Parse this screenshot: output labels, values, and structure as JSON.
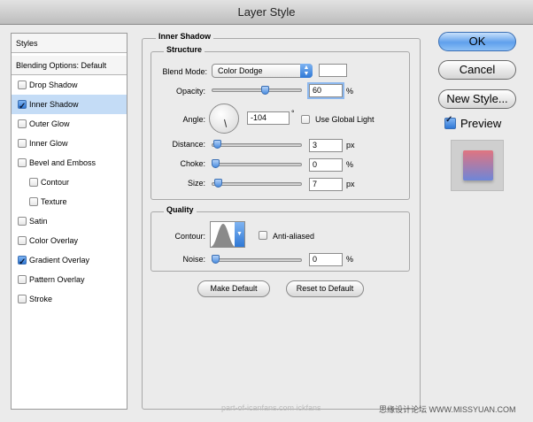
{
  "window": {
    "title": "Layer Style"
  },
  "sidebar": {
    "header": "Styles",
    "blending": "Blending Options: Default",
    "items": [
      {
        "label": "Drop Shadow",
        "checked": false,
        "selected": false,
        "indent": false
      },
      {
        "label": "Inner Shadow",
        "checked": true,
        "selected": true,
        "indent": false
      },
      {
        "label": "Outer Glow",
        "checked": false,
        "selected": false,
        "indent": false
      },
      {
        "label": "Inner Glow",
        "checked": false,
        "selected": false,
        "indent": false
      },
      {
        "label": "Bevel and Emboss",
        "checked": false,
        "selected": false,
        "indent": false
      },
      {
        "label": "Contour",
        "checked": false,
        "selected": false,
        "indent": true
      },
      {
        "label": "Texture",
        "checked": false,
        "selected": false,
        "indent": true
      },
      {
        "label": "Satin",
        "checked": false,
        "selected": false,
        "indent": false
      },
      {
        "label": "Color Overlay",
        "checked": false,
        "selected": false,
        "indent": false
      },
      {
        "label": "Gradient Overlay",
        "checked": true,
        "selected": false,
        "indent": false
      },
      {
        "label": "Pattern Overlay",
        "checked": false,
        "selected": false,
        "indent": false
      },
      {
        "label": "Stroke",
        "checked": false,
        "selected": false,
        "indent": false
      }
    ]
  },
  "inner_shadow": {
    "section_title": "Inner Shadow",
    "structure": {
      "title": "Structure",
      "blend_mode_label": "Blend Mode:",
      "blend_mode_value": "Color Dodge",
      "blend_color": "#ffffff",
      "opacity_label": "Opacity:",
      "opacity_value": "60",
      "opacity_unit": "%",
      "opacity_fraction": 0.6,
      "angle_label": "Angle:",
      "angle_value": "-104",
      "angle_unit": "°",
      "use_global_light_label": "Use Global Light",
      "use_global_light_checked": false,
      "distance_label": "Distance:",
      "distance_value": "3",
      "distance_unit": "px",
      "distance_fraction": 0.02,
      "choke_label": "Choke:",
      "choke_value": "0",
      "choke_unit": "%",
      "choke_fraction": 0,
      "size_label": "Size:",
      "size_value": "7",
      "size_unit": "px",
      "size_fraction": 0.03
    },
    "quality": {
      "title": "Quality",
      "contour_label": "Contour:",
      "anti_aliased_label": "Anti-aliased",
      "anti_aliased_checked": false,
      "noise_label": "Noise:",
      "noise_value": "0",
      "noise_unit": "%",
      "noise_fraction": 0
    },
    "make_default_label": "Make Default",
    "reset_default_label": "Reset to Default"
  },
  "buttons": {
    "ok": "OK",
    "cancel": "Cancel",
    "new_style": "New Style...",
    "preview_label": "Preview",
    "preview_checked": true
  },
  "watermark": {
    "left": "part-of-icanfans.com ickfans",
    "right": "思缘设计论坛 WWW.MISSYUAN.COM"
  },
  "colors": {
    "accent": "#3a7fd9",
    "selected_row": "#c4dcf6",
    "preview_top": "#e07480",
    "preview_bottom": "#6e86d8"
  }
}
